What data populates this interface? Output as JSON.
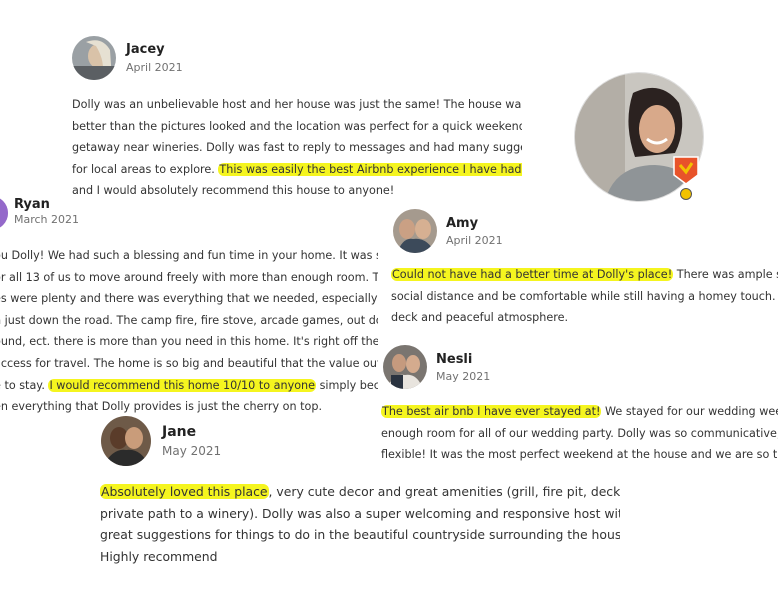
{
  "reviews": {
    "jacey": {
      "name": "Jacey",
      "date": "April 2021",
      "lines": [
        {
          "pre": "Dolly was an unbelievable host and her house was just the same! The house was even",
          "hl": "",
          "post": ""
        },
        {
          "pre": "better than the pictures looked and the location was perfect for a quick weekend",
          "hl": "",
          "post": ""
        },
        {
          "pre": "getaway near wineries. Dolly was fast to reply to messages and had many suggestions",
          "hl": "",
          "post": ""
        },
        {
          "pre": "for local areas to explore. ",
          "hl": "This was easily the best Airbnb experience I have had so far,",
          "post": ""
        },
        {
          "pre": "and I would absolutely recommend this house to anyone!",
          "hl": "",
          "post": ""
        }
      ]
    },
    "ryan": {
      "name": "Ryan",
      "date": "March 2021",
      "lines": [
        {
          "pre": "ou Dolly! We had such a blessing and fun time in your home. It was such a big",
          "hl": "",
          "post": ""
        },
        {
          "pre": "or all 13 of us to move around freely with more than enough room. The",
          "hl": "",
          "post": ""
        },
        {
          "pre": "es were plenty and there was everything that we needed, especially with the",
          "hl": "",
          "post": ""
        },
        {
          "pre": "n just down the road. The camp fire, fire stove, arcade games, out door games,",
          "hl": "",
          "post": ""
        },
        {
          "pre": "ound, ect. there is more than you need in this home. It's right off the high way so",
          "hl": "",
          "post": ""
        },
        {
          "pre": " access for travel. The home is so big and beautiful that the value out weighs",
          "hl": "",
          "post": ""
        },
        {
          "pre": "e to stay. ",
          "hl": "I would recommend this home 10/10 to anyone",
          "post": " simply because of"
        },
        {
          "pre": "en everything that Dolly provides is just the cherry on top.",
          "hl": "",
          "post": ""
        }
      ]
    },
    "amy": {
      "name": "Amy",
      "date": "April 2021",
      "lines": [
        {
          "pre": "",
          "hl": "Could not have had a better time at Dolly's place!",
          "post": " There was ample space to p"
        },
        {
          "pre": "social distance and be comfortable while still having a homey touch. We loved",
          "hl": "",
          "post": ""
        },
        {
          "pre": "deck and peaceful atmosphere.",
          "hl": "",
          "post": ""
        }
      ]
    },
    "nesli": {
      "name": "Nesli",
      "date": "May 2021",
      "lines": [
        {
          "pre": "",
          "hl": "The best air bnb I have ever stayed at!",
          "post": " We stayed for our wedding weekend an"
        },
        {
          "pre": "enough room for all of our wedding party. Dolly was so communicative, graciou",
          "hl": "",
          "post": ""
        },
        {
          "pre": "flexible! It was the most perfect weekend at the house and we are so thankful!",
          "hl": "",
          "post": ""
        }
      ]
    },
    "jane": {
      "name": "Jane",
      "date": "May 2021",
      "lines": [
        {
          "pre": "",
          "hl": "Absolutely loved this place",
          "post": ", very cute decor and great amenities (grill, fire pit, deck,"
        },
        {
          "pre": "private path to a winery). Dolly was also a super welcoming and responsive host with",
          "hl": "",
          "post": ""
        },
        {
          "pre": "great suggestions for things to do in the beautiful countryside surrounding the house.",
          "hl": "",
          "post": ""
        },
        {
          "pre": "Highly recommend",
          "hl": "",
          "post": ""
        }
      ]
    }
  },
  "colors": {
    "highlight": "#f5f51f",
    "badge": "#e8532a",
    "badge_accent": "#f2c200"
  },
  "icons": {
    "host_badge": "superhost-badge-icon"
  }
}
